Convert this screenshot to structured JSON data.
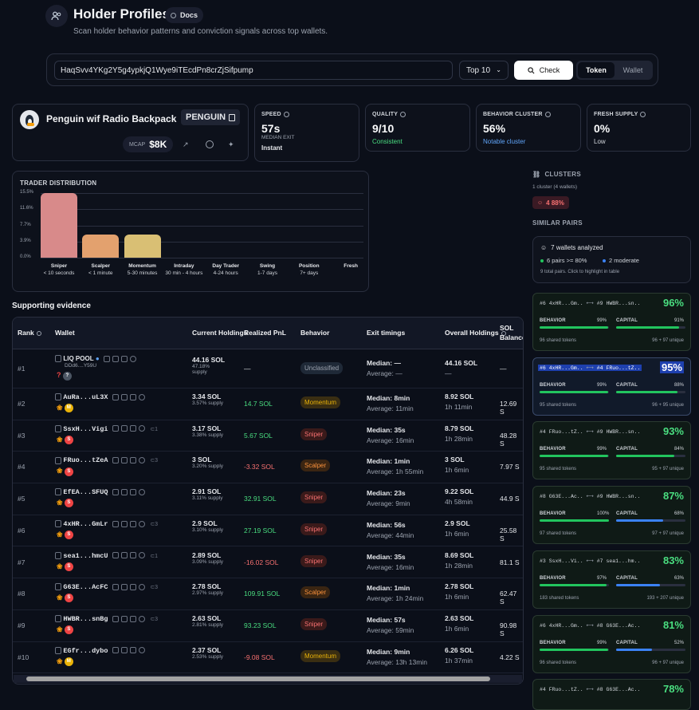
{
  "header": {
    "title": "Holder Profiles",
    "docs": "Docs",
    "subtitle": "Scan holder behavior patterns and conviction signals across top wallets."
  },
  "search": {
    "address": "HaqSvv4YKg2Y5g4ypkjQ1Wye9iTEcdPn8crZjSifpump",
    "top": "Top 10",
    "check": "Check",
    "toggle": [
      "Token",
      "Wallet"
    ]
  },
  "token": {
    "name": "Penguin wif Radio Backpack",
    "symbol": "PENGUIN",
    "mcap_label": "MCAP",
    "mcap": "$8K"
  },
  "stats": [
    {
      "label": "SPEED",
      "value": "57s",
      "sub1": "MEDIAN EXIT",
      "sub2": "Instant",
      "color": "#e5e7eb"
    },
    {
      "label": "QUALITY",
      "value": "9/10",
      "sub2": "Consistent",
      "color": "#4ade80"
    },
    {
      "label": "BEHAVIOR CLUSTER",
      "value": "56%",
      "sub2": "Notable cluster",
      "color": "#60a5fa"
    },
    {
      "label": "FRESH SUPPLY",
      "value": "0%",
      "sub2": "Low",
      "color": "#d1d5db"
    }
  ],
  "chart_data": {
    "type": "bar",
    "title": "TRADER DISTRIBUTION",
    "yticks": [
      "15.5%",
      "11.6%",
      "7.7%",
      "3.9%",
      "0.0%"
    ],
    "ylim": [
      0,
      15.5
    ],
    "categories": [
      {
        "name": "Sniper",
        "sub": "< 10 seconds"
      },
      {
        "name": "Scalper",
        "sub": "< 1 minute"
      },
      {
        "name": "Momentum",
        "sub": "5-30 minutes"
      },
      {
        "name": "Intraday",
        "sub": "30 min - 4 hours"
      },
      {
        "name": "Day Trader",
        "sub": "4-24 hours"
      },
      {
        "name": "Swing",
        "sub": "1-7 days"
      },
      {
        "name": "Position",
        "sub": "7+ days"
      },
      {
        "name": "Fresh",
        "sub": ""
      }
    ],
    "values": [
      15.5,
      5.6,
      5.6,
      0,
      0,
      0,
      0,
      0
    ],
    "colors": [
      "#d88a8a",
      "#e3a16e",
      "#d9bf74"
    ]
  },
  "evidence": {
    "title": "Supporting evidence",
    "headers": [
      "Rank",
      "Wallet",
      "Current Holdings",
      "Realized PnL",
      "Behavior",
      "Exit timings",
      "Overall Holdings",
      "SOL Balance"
    ],
    "rows": [
      {
        "rank": "#1",
        "wallet": "LIQ POOL",
        "addr": "DDd6....Y59U",
        "hold": "44.16 SOL",
        "pct": "47.18%",
        "pct2": "supply",
        "pnl": "—",
        "pnlc": "#e5e7eb",
        "beh": "Unclassified",
        "med": "Median: —",
        "avg": "Average: —",
        "ov": "44.16 SOL",
        "ovt": "—",
        "sol": "—",
        "badge": "?",
        "links": ""
      },
      {
        "rank": "#2",
        "wallet": "AuRa...uL3X",
        "hold": "3.34 SOL",
        "pct": "3.57% supply",
        "pnl": "14.7 SOL",
        "pnlc": "#4ade80",
        "beh": "Momentum",
        "med": "Median: 8min",
        "avg": "Average: 11min",
        "ov": "8.92 SOL",
        "ovt": "1h 11min",
        "sol": "12.69 S",
        "badge": "M",
        "links": ""
      },
      {
        "rank": "#3",
        "wallet": "SsxH...Vigi",
        "hold": "3.17 SOL",
        "pct": "3.38% supply",
        "pnl": "5.67 SOL",
        "pnlc": "#4ade80",
        "beh": "Sniper",
        "med": "Median: 35s",
        "avg": "Average: 16min",
        "ov": "8.79 SOL",
        "ovt": "1h 28min",
        "sol": "48.28 S",
        "badge": "S",
        "links": "1"
      },
      {
        "rank": "#4",
        "wallet": "FRuo...tZeA",
        "hold": "3 SOL",
        "pct": "3.20% supply",
        "pnl": "-3.32 SOL",
        "pnlc": "#f87171",
        "beh": "Scalper",
        "med": "Median: 1min",
        "avg": "Average: 1h 55min",
        "ov": "3 SOL",
        "ovt": "1h 6min",
        "sol": "7.97 S",
        "badge": "S",
        "links": "3"
      },
      {
        "rank": "#5",
        "wallet": "EfEA...SFUQ",
        "hold": "2.91 SOL",
        "pct": "3.11% supply",
        "pnl": "32.91 SOL",
        "pnlc": "#4ade80",
        "beh": "Sniper",
        "med": "Median: 23s",
        "avg": "Average: 9min",
        "ov": "9.22 SOL",
        "ovt": "4h 58min",
        "sol": "44.9 S",
        "badge": "S",
        "links": ""
      },
      {
        "rank": "#6",
        "wallet": "4xHR...GmLr",
        "hold": "2.9 SOL",
        "pct": "3.10% supply",
        "pnl": "27.19 SOL",
        "pnlc": "#4ade80",
        "beh": "Sniper",
        "med": "Median: 56s",
        "avg": "Average: 44min",
        "ov": "2.9 SOL",
        "ovt": "1h 6min",
        "sol": "25.58 S",
        "badge": "S",
        "links": "3"
      },
      {
        "rank": "#7",
        "wallet": "sea1...hmcU",
        "hold": "2.89 SOL",
        "pct": "3.09% supply",
        "pnl": "-16.02 SOL",
        "pnlc": "#f87171",
        "beh": "Sniper",
        "med": "Median: 35s",
        "avg": "Average: 16min",
        "ov": "8.69 SOL",
        "ovt": "1h 28min",
        "sol": "81.1 S",
        "badge": "S",
        "links": "1"
      },
      {
        "rank": "#8",
        "wallet": "G63E...AcFC",
        "hold": "2.78 SOL",
        "pct": "2.97% supply",
        "pnl": "109.91 SOL",
        "pnlc": "#4ade80",
        "beh": "Scalper",
        "med": "Median: 1min",
        "avg": "Average: 1h 24min",
        "ov": "2.78 SOL",
        "ovt": "1h 6min",
        "sol": "62.47 S",
        "badge": "S",
        "links": "3"
      },
      {
        "rank": "#9",
        "wallet": "HWBR...snBg",
        "hold": "2.63 SOL",
        "pct": "2.81% supply",
        "pnl": "93.23 SOL",
        "pnlc": "#4ade80",
        "beh": "Sniper",
        "med": "Median: 57s",
        "avg": "Average: 59min",
        "ov": "2.63 SOL",
        "ovt": "1h 6min",
        "sol": "90.98 S",
        "badge": "S",
        "links": "3"
      },
      {
        "rank": "#10",
        "wallet": "EGfr...dybo",
        "hold": "2.37 SOL",
        "pct": "2.53% supply",
        "pnl": "-9.08 SOL",
        "pnlc": "#f87171",
        "beh": "Momentum",
        "med": "Median: 9min",
        "avg": "Average: 13h 13min",
        "ov": "6.26 SOL",
        "ovt": "1h 37min",
        "sol": "4.22 S",
        "badge": "M",
        "links": ""
      }
    ]
  },
  "clusters": {
    "title": "CLUSTERS",
    "sub": "1 cluster (4 wallets)",
    "chip": "4 88%",
    "similar": "SIMILAR PAIRS",
    "wallets": "7 wallets analyzed",
    "pairs80": "6 pairs >= 80%",
    "moderate": "2 moderate",
    "note": "9 total pairs. Click to highlight in table"
  },
  "pairs": [
    {
      "a": "#6 4xHR...Gm..",
      "b": "#9 HWBR...sn..",
      "pct": "96%",
      "beh": "99%",
      "cap": "91%",
      "capc": "#22c55e",
      "shared": "96 shared tokens",
      "uniq": "96 + 97 unique",
      "sel": false
    },
    {
      "a": "#6 4xHR...Gm..",
      "b": "#4 FRuo...tZ..",
      "pct": "95%",
      "beh": "99%",
      "cap": "88%",
      "capc": "#22c55e",
      "shared": "95 shared tokens",
      "uniq": "96 + 95 unique",
      "sel": true
    },
    {
      "a": "#4 FRuo...tZ..",
      "b": "#9 HWBR...sn..",
      "pct": "93%",
      "beh": "99%",
      "cap": "84%",
      "capc": "#22c55e",
      "shared": "95 shared tokens",
      "uniq": "95 + 97 unique",
      "sel": false
    },
    {
      "a": "#8 G63E...Ac..",
      "b": "#9 HWBR...sn..",
      "pct": "87%",
      "beh": "100%",
      "cap": "68%",
      "capc": "#3b82f6",
      "shared": "97 shared tokens",
      "uniq": "97 + 97 unique",
      "sel": false
    },
    {
      "a": "#3 SsxH...Vi..",
      "b": "#7 sea1...hm..",
      "pct": "83%",
      "beh": "97%",
      "cap": "63%",
      "capc": "#3b82f6",
      "shared": "183 shared tokens",
      "uniq": "193 + 207 unique",
      "sel": false
    },
    {
      "a": "#6 4xHR...Gm..",
      "b": "#8 G63E...Ac..",
      "pct": "81%",
      "beh": "99%",
      "cap": "52%",
      "capc": "#3b82f6",
      "shared": "96 shared tokens",
      "uniq": "96 + 97 unique",
      "sel": false
    },
    {
      "a": "#4 FRuo...tZ..",
      "b": "#8 G63E...Ac..",
      "pct": "78%",
      "beh": "",
      "cap": "",
      "capc": "#3b82f6",
      "shared": "",
      "uniq": "",
      "sel": false
    }
  ],
  "labels": {
    "behavior": "BEHAVIOR",
    "capital": "CAPITAL"
  }
}
